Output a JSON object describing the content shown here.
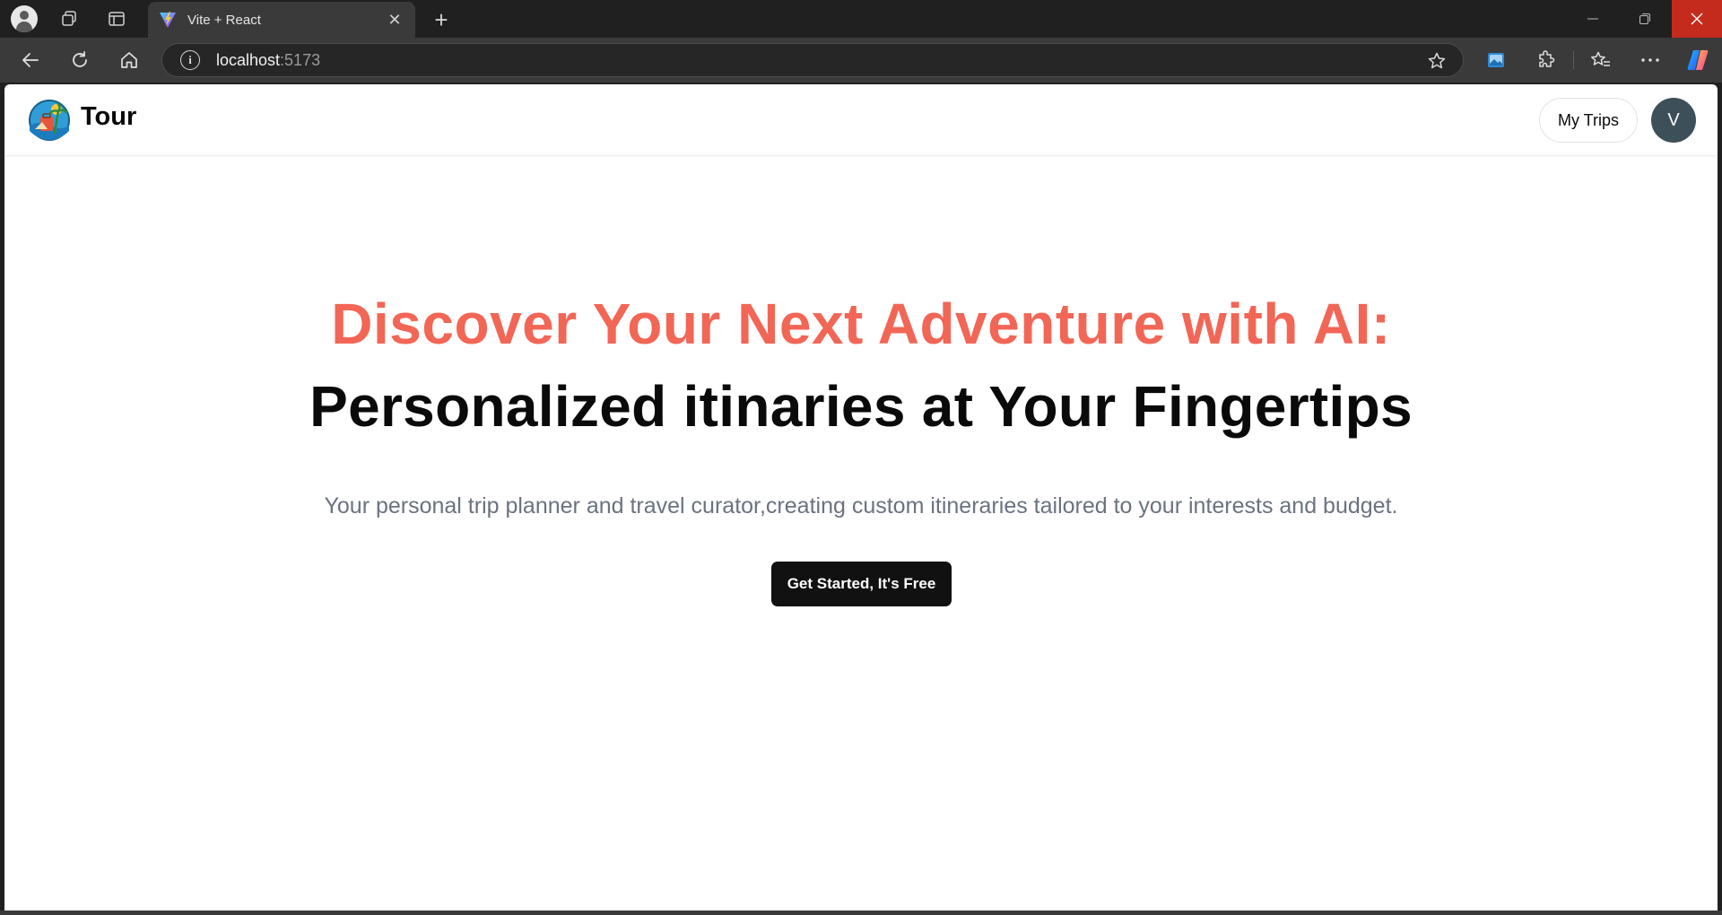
{
  "browser": {
    "tab": {
      "title": "Vite + React",
      "close": "✕"
    },
    "newtab": "+",
    "address": {
      "host": "localhost",
      "port": ":5173",
      "info": "i"
    },
    "window": {
      "minimize": "—",
      "close": "✕"
    }
  },
  "site": {
    "brand": "Tour",
    "nav": {
      "my_trips": "My Trips"
    },
    "avatar_initial": "V"
  },
  "hero": {
    "line1": "Discover Your Next Adventure with AI:",
    "line2": "Personalized itinaries at Your Fingertips",
    "subtitle": "Your personal trip planner and travel curator,creating custom itineraries tailored to your interests and budget.",
    "cta": "Get Started, It's Free"
  },
  "colors": {
    "accent": "#f26656",
    "cta_bg": "#111111",
    "avatar_bg": "#3d505a",
    "browser_close": "#c42b1c"
  },
  "icons": [
    "profile-icon",
    "workspaces-icon",
    "tab-actions-icon",
    "vite-favicon",
    "back-icon",
    "refresh-icon",
    "home-icon",
    "info-icon",
    "favorite-star-icon",
    "screenshot-icon",
    "extensions-icon",
    "favorites-icon",
    "more-icon",
    "copilot-icon",
    "tour-logo-icon"
  ]
}
